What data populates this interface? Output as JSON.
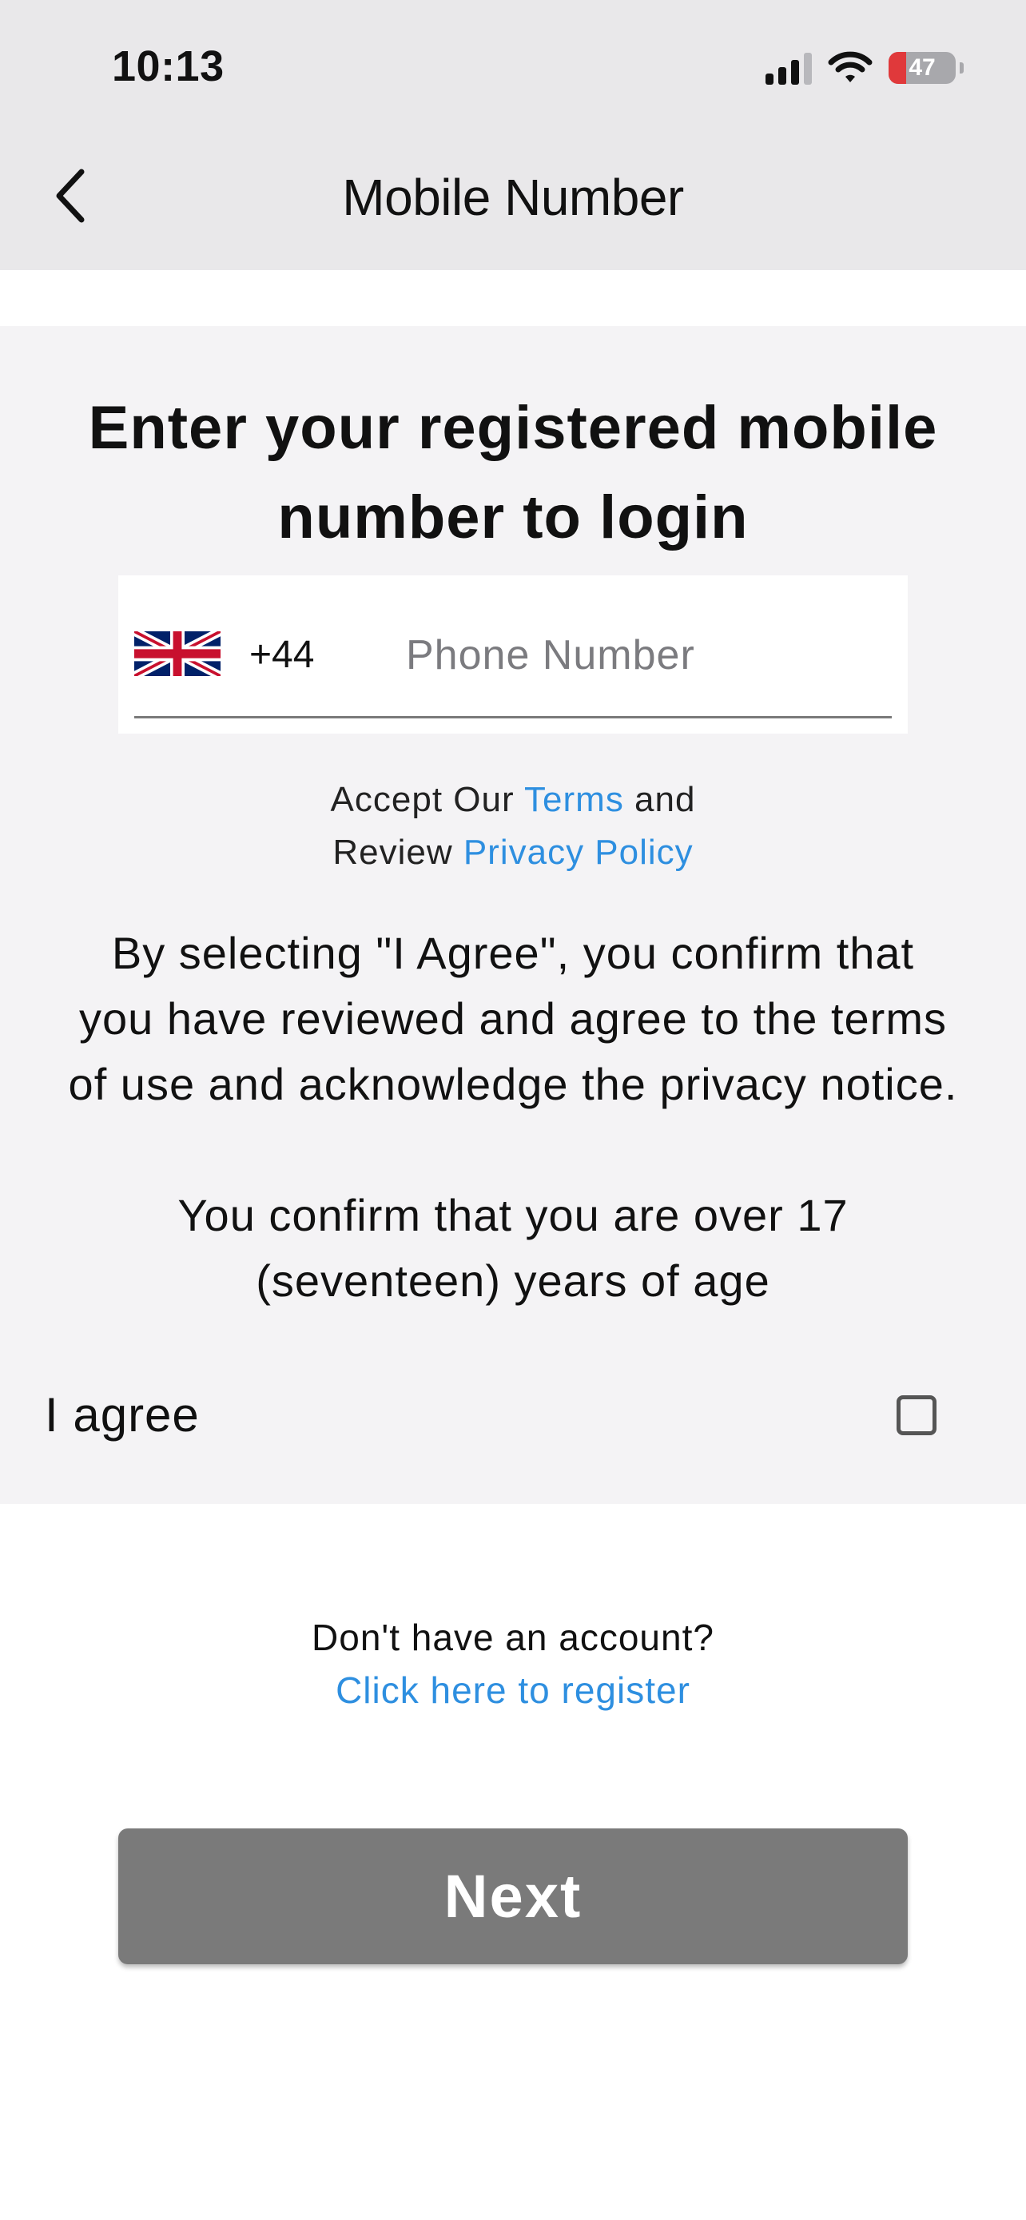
{
  "status_bar": {
    "time": "10:13",
    "battery_level": "47",
    "signal_bars_active": 3,
    "icons": [
      "cellular-signal-icon",
      "wifi-icon",
      "battery-icon"
    ]
  },
  "nav": {
    "title": "Mobile Number",
    "back_icon": "chevron-left-icon"
  },
  "login": {
    "heading_line1": "Enter your registered mobile",
    "heading_line2": "number to login",
    "phone": {
      "country_flag": "uk-flag-icon",
      "country_code": "+44",
      "placeholder": "Phone Number",
      "value": ""
    },
    "terms": {
      "accept_prefix": "Accept Our ",
      "terms_link": "Terms",
      "and": " and",
      "review_prefix": "Review ",
      "privacy_link": "Privacy Policy"
    },
    "consent_line1": "By selecting \"I Agree\", you confirm that",
    "consent_line2": "you have reviewed and agree to the terms",
    "consent_line3": "of use and acknowledge the privacy notice.",
    "age_line1": "You confirm that you are over 17",
    "age_line2": "(seventeen) years of age",
    "agree_label": "I agree",
    "agree_checked": false
  },
  "register": {
    "question": "Don't have an account?",
    "link": "Click here to register"
  },
  "next_button": {
    "label": "Next"
  },
  "colors": {
    "header_bg": "#e9e8ea",
    "panel_bg": "#f4f3f5",
    "link": "#2e8fe0",
    "button_bg": "#7a7a7a",
    "battery_low": "#e0393b"
  }
}
